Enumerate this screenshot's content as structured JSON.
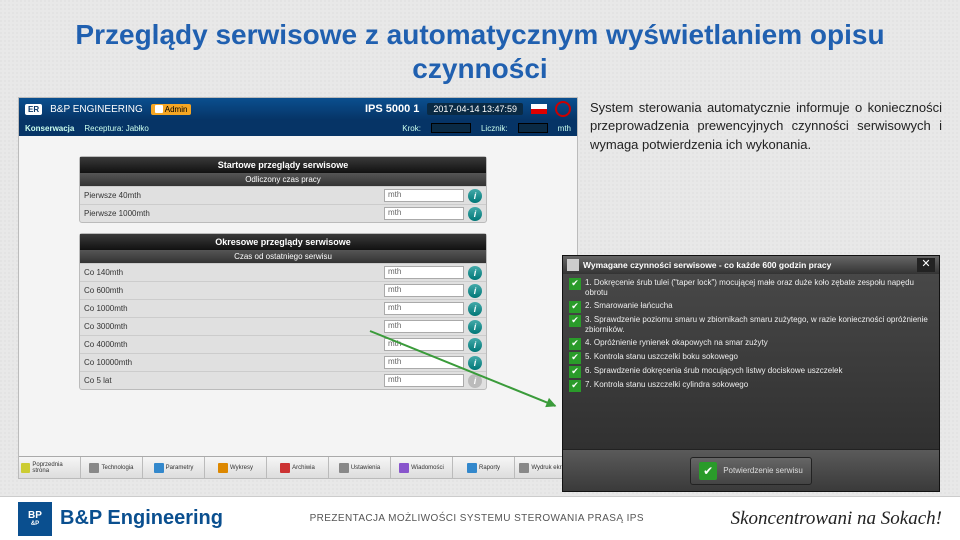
{
  "title": "Przeglądy serwisowe z automatycznym wyświetlaniem opisu czynności",
  "description": "System sterowania automatycznie informuje o konieczności przeprowadzenia prewencyjnych czynności serwisowych i wymaga potwierdzenia ich wykonania.",
  "hmi": {
    "top": {
      "brand": "B&P ENGINEERING",
      "user": "Admin",
      "ips": "IPS 5000  1",
      "datetime": "2017-04-14 13:47:59"
    },
    "sub": {
      "left1": "Konserwacja",
      "left2": "Receptura: Jabłko",
      "mid": "Krok:",
      "licz": "Licznik:",
      "unit": "mth"
    },
    "panel1": {
      "header": "Startowe przeglądy serwisowe",
      "sub": "Odliczony czas pracy",
      "rows": [
        {
          "label": "Pierwsze 40mth",
          "val": "mth"
        },
        {
          "label": "Pierwsze 1000mth",
          "val": "mth"
        }
      ]
    },
    "panel2": {
      "header": "Okresowe przeglądy serwisowe",
      "sub": "Czas od ostatniego serwisu",
      "rows": [
        {
          "label": "Co 140mth",
          "val": "mth"
        },
        {
          "label": "Co 600mth",
          "val": "mth"
        },
        {
          "label": "Co 1000mth",
          "val": "mth"
        },
        {
          "label": "Co 3000mth",
          "val": "mth"
        },
        {
          "label": "Co 4000mth",
          "val": "mth"
        },
        {
          "label": "Co 10000mth",
          "val": "mth"
        },
        {
          "label": "Co 5 lat",
          "val": "mth"
        }
      ]
    },
    "toolbar": [
      "Poprzednia strona",
      "Technologia",
      "Parametry",
      "Wykresy",
      "Archiwia",
      "Ustawienia",
      "Wiadomości",
      "Raporty",
      "Wydruk ekranu"
    ]
  },
  "dialog": {
    "title": "Wymagane czynności serwisowe - co każde 600 godzin pracy",
    "tasks": [
      "1. Dokręcenie śrub tulei (\"taper lock\") mocującej małe oraz duże koło zębate zespołu napędu obrotu",
      "2. Smarowanie łańcucha",
      "3. Sprawdzenie poziomu smaru w zbiornikach smaru zużytego, w razie konieczności opróżnienie zbiorników.",
      "4. Opróżnienie rynienek okapowych na smar zużyty",
      "5. Kontrola stanu uszczelki boku sokowego",
      "6. Sprawdzenie dokręcenia śrub mocujących listwy dociskowe uszczelek",
      "7. Kontrola stanu uszczelki cylindra sokowego"
    ],
    "confirm": "Potwierdzenie serwisu"
  },
  "footer": {
    "brand": "B&P Engineering",
    "mid": "PREZENTACJA MOŻLIWOŚCI SYSTEMU STEROWANIA PRASĄ IPS",
    "right": "Skoncentrowani na Sokach!"
  }
}
